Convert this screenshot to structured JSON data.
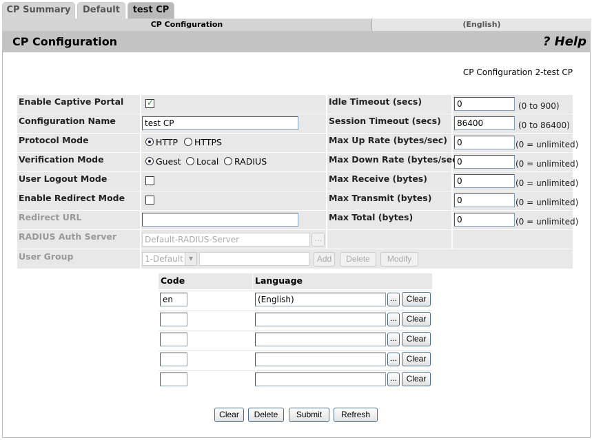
{
  "tabs": [
    "CP Summary",
    "Default",
    "test CP"
  ],
  "subheader": {
    "left": "CP Configuration",
    "right": "(English)"
  },
  "title": "CP Configuration",
  "help": "? Help",
  "config_caption": "CP Configuration 2-test CP",
  "left_labels": {
    "enable_captive_portal": "Enable Captive Portal",
    "configuration_name": "Configuration Name",
    "protocol_mode": "Protocol Mode",
    "verification_mode": "Verification Mode",
    "user_logout_mode": "User Logout Mode",
    "enable_redirect_mode": "Enable Redirect Mode",
    "redirect_url": "Redirect URL",
    "radius_auth_server": "RADIUS Auth Server",
    "user_group": "User Group"
  },
  "values": {
    "enable_captive_portal_checked": true,
    "configuration_name": "test CP",
    "protocol_options": [
      "HTTP",
      "HTTPS"
    ],
    "protocol_selected": "HTTP",
    "verification_options": [
      "Guest",
      "Local",
      "RADIUS"
    ],
    "verification_selected": "Guest",
    "user_logout_checked": false,
    "enable_redirect_checked": false,
    "redirect_url": "",
    "radius_server": "Default-RADIUS-Server",
    "user_group_selected": "1-Default",
    "user_group_text": ""
  },
  "browse_label": "...",
  "group_buttons": [
    "Add",
    "Delete",
    "Modify"
  ],
  "right_fields": [
    {
      "label": "Idle Timeout (secs)",
      "value": "0",
      "hint": "(0 to 900)"
    },
    {
      "label": "Session Timeout (secs)",
      "value": "86400",
      "hint": "(0 to 86400)"
    },
    {
      "label": "Max Up Rate (bytes/sec)",
      "value": "0",
      "hint": "(0 = unlimited)"
    },
    {
      "label": "Max Down Rate (bytes/sec)",
      "value": "0",
      "hint": "(0 = unlimited)"
    },
    {
      "label": "Max Receive (bytes)",
      "value": "0",
      "hint": "(0 = unlimited)"
    },
    {
      "label": "Max Transmit (bytes)",
      "value": "0",
      "hint": "(0 = unlimited)"
    },
    {
      "label": "Max Total (bytes)",
      "value": "0",
      "hint": "(0 = unlimited)"
    }
  ],
  "locale_table": {
    "headers": [
      "Code",
      "Language"
    ],
    "rows": [
      {
        "code": "en",
        "language": "(English)"
      },
      {
        "code": "",
        "language": ""
      },
      {
        "code": "",
        "language": ""
      },
      {
        "code": "",
        "language": ""
      },
      {
        "code": "",
        "language": ""
      }
    ],
    "clear_label": "Clear"
  },
  "footer_buttons": [
    "Clear",
    "Delete",
    "Submit",
    "Refresh"
  ]
}
